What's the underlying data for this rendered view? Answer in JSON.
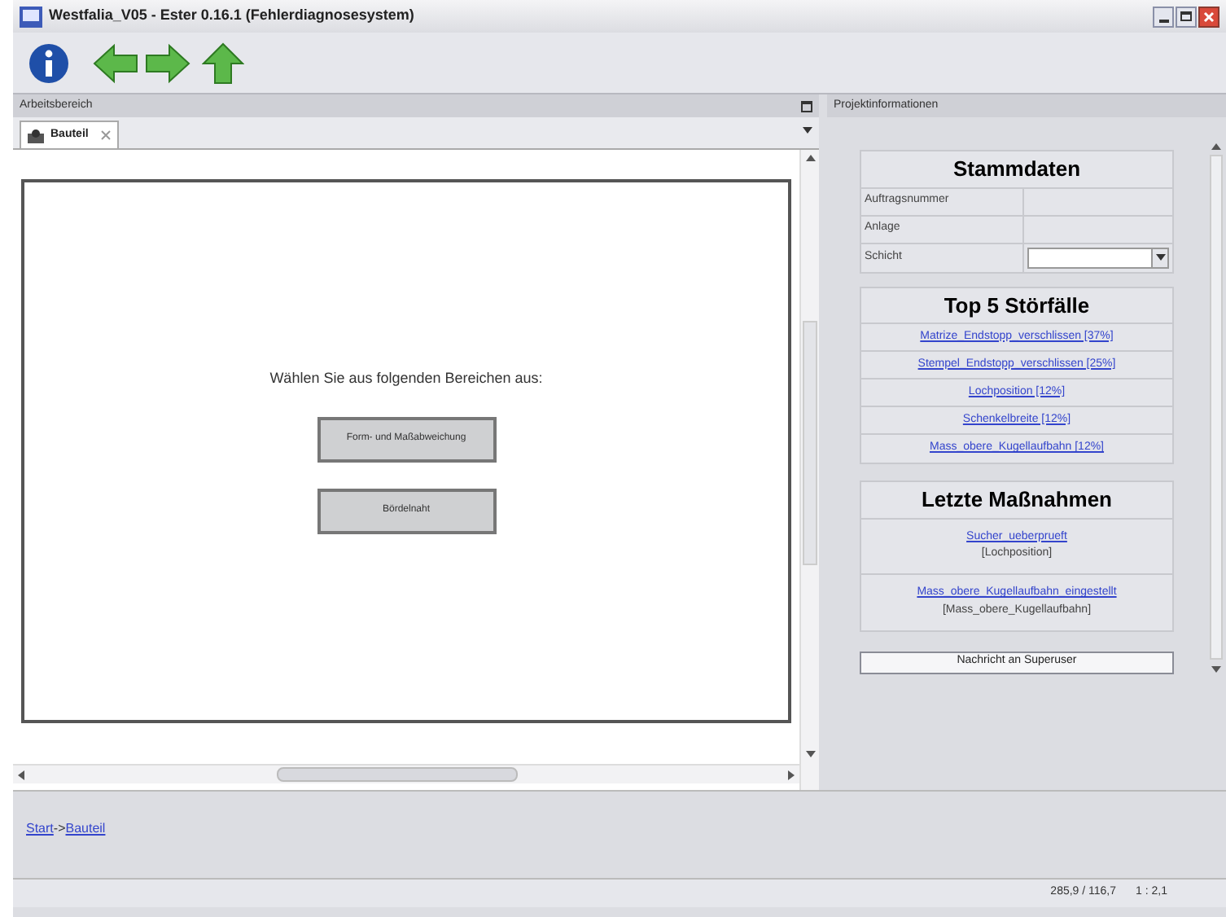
{
  "window": {
    "title": "Westfalia_V05 - Ester 0.16.1 (Fehlerdiagnosesystem)"
  },
  "workspace": {
    "header": "Arbeitsbereich",
    "tabs": [
      {
        "label": "Bauteil",
        "selected": true
      }
    ],
    "prompt": "Wählen Sie aus folgenden Bereichen aus:",
    "buttons": [
      "Form- und Maßabweichung",
      "Bördelnaht"
    ]
  },
  "breadcrumb": [
    "Start",
    "Bauteil"
  ],
  "breadcrumb_separator": "->",
  "project_info": {
    "header": "Projektinformationen",
    "master_data": {
      "title": "Stammdaten",
      "rows": [
        {
          "label": "Auftragsnummer",
          "kind": "text"
        },
        {
          "label": "Anlage",
          "kind": "text"
        },
        {
          "label": "Schicht",
          "kind": "dropdown"
        }
      ]
    },
    "top_faults": {
      "title": "Top 5 Störfälle",
      "items": [
        "Matrize_Endstopp_verschlissen [37%]",
        "Stempel_Endstopp_verschlissen [25%]",
        "Lochposition [12%]",
        "Schenkelbreite [12%]",
        "Mass_obere_Kugellaufbahn [12%]"
      ]
    },
    "last_actions": {
      "title": "Letzte Maßnahmen",
      "items": [
        {
          "action": "Sucher_ueberprueft",
          "target": "[Lochposition]"
        },
        {
          "action": "Mass_obere_Kugellaufbahn_eingestellt",
          "target": "[Mass_obere_Kugellaufbahn]"
        }
      ]
    },
    "button": "Nachricht an Superuser"
  },
  "status_bar": {
    "coordinates": "285,9 / 116,7",
    "scale": "1 : 2,1"
  }
}
